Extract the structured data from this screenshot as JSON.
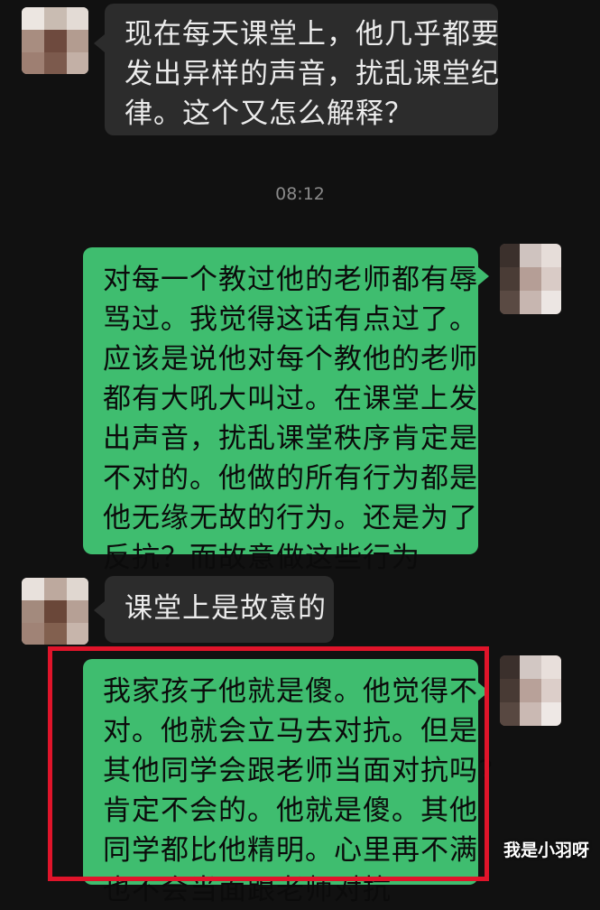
{
  "chat": {
    "timestamp": "08:12",
    "messages": [
      {
        "side": "left",
        "lines": [
          "现在每天课堂上，他几乎都要",
          "发出异样的声音，扰乱课堂纪",
          "律。这个又怎么解释？"
        ]
      },
      {
        "side": "right",
        "lines": [
          "对每一个教过他的老师都有辱",
          "骂过。我觉得这话有点过了。",
          "应该是说他对每个教他的老师",
          "都有大吼大叫过。在课堂上发",
          "出声音，扰乱课堂秩序肯定是",
          "不对的。他做的所有行为都是",
          "他无缘无故的行为。还是为了",
          "反抗？而故意做这些行为"
        ]
      },
      {
        "side": "left",
        "lines": [
          "课堂上是故意的"
        ]
      },
      {
        "side": "right",
        "lines": [
          "我家孩子他就是傻。他觉得不",
          "对。他就会立马去对抗。但是",
          "其他同学会跟老师当面对抗吗?",
          "肯定不会的。他就是傻。其他",
          "同学都比他精明。心里再不满",
          "也不会当面跟老师对抗"
        ]
      }
    ]
  },
  "watermark": "我是小羽呀",
  "colors": {
    "background": "#111111",
    "left_bubble": "#2c2c2c",
    "right_bubble": "#3fbd6f",
    "highlight": "#e0142a"
  },
  "icons": {
    "left_avatar": "blurred-avatar-icon",
    "right_avatar": "blurred-avatar-icon"
  }
}
